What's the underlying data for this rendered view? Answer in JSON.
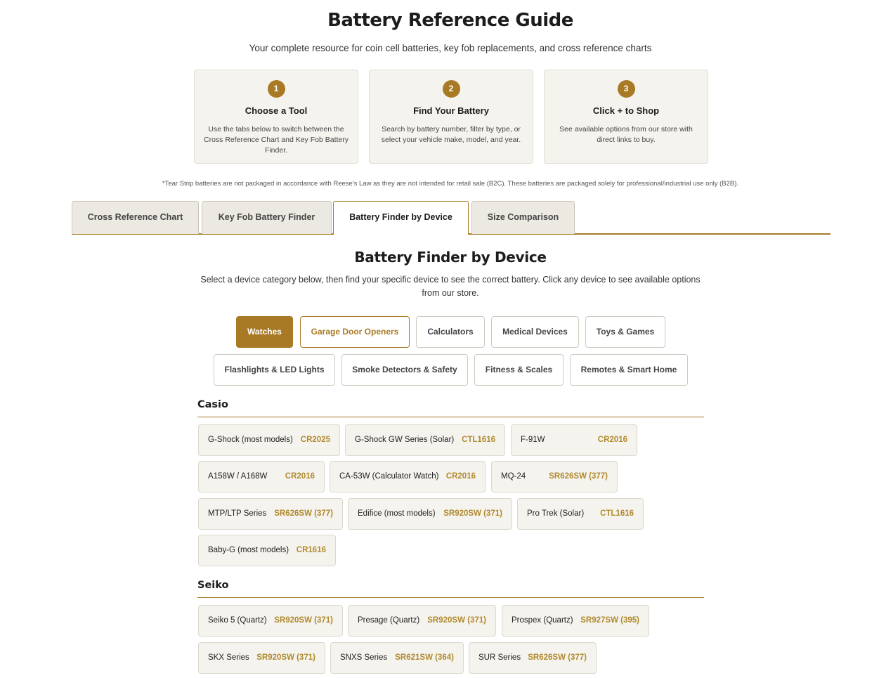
{
  "header": {
    "title": "Battery Reference Guide",
    "subtitle": "Your complete resource for coin cell batteries, key fob replacements, and cross reference charts"
  },
  "steps": [
    {
      "number": "1",
      "title": "Choose a Tool",
      "desc": "Use the tabs below to switch between the Cross Reference Chart and Key Fob Battery Finder."
    },
    {
      "number": "2",
      "title": "Find Your Battery",
      "desc": "Search by battery number, filter by type, or select your vehicle make, model, and year."
    },
    {
      "number": "3",
      "title": "Click + to Shop",
      "desc": "See available options from our store with direct links to buy."
    }
  ],
  "disclaimer": "*Tear Strip batteries are not packaged in accordance with Reese's Law as they are not intended for retail sale (B2C). These batteries are packaged solely for professional/industrial use only (B2B).",
  "tabs": [
    "Cross Reference Chart",
    "Key Fob Battery Finder",
    "Battery Finder by Device",
    "Size Comparison"
  ],
  "active_tab": "Battery Finder by Device",
  "section": {
    "title": "Battery Finder by Device",
    "desc": "Select a device category below, then find your specific device to see the correct battery. Click any device to see available options from our store."
  },
  "categories": [
    "Watches",
    "Garage Door Openers",
    "Calculators",
    "Medical Devices",
    "Toys & Games",
    "Flashlights & LED Lights",
    "Smoke Detectors & Safety",
    "Fitness & Scales",
    "Remotes & Smart Home"
  ],
  "active_category": "Watches",
  "brands": [
    {
      "name": "Casio",
      "devices": [
        {
          "name": "G-Shock (most models)",
          "battery": "CR2025"
        },
        {
          "name": "G-Shock GW Series (Solar)",
          "battery": "CTL1616"
        },
        {
          "name": "F-91W",
          "battery": "CR2016"
        },
        {
          "name": "A158W / A168W",
          "battery": "CR2016"
        },
        {
          "name": "CA-53W (Calculator Watch)",
          "battery": "CR2016"
        },
        {
          "name": "MQ-24",
          "battery": "SR626SW (377)"
        },
        {
          "name": "MTP/LTP Series",
          "battery": "SR626SW (377)"
        },
        {
          "name": "Edifice (most models)",
          "battery": "SR920SW (371)"
        },
        {
          "name": "Pro Trek (Solar)",
          "battery": "CTL1616"
        },
        {
          "name": "Baby-G (most models)",
          "battery": "CR1616"
        }
      ]
    },
    {
      "name": "Seiko",
      "devices": [
        {
          "name": "Seiko 5 (Quartz)",
          "battery": "SR920SW (371)"
        },
        {
          "name": "Presage (Quartz)",
          "battery": "SR920SW (371)"
        },
        {
          "name": "Prospex (Quartz)",
          "battery": "SR927SW (395)"
        },
        {
          "name": "SKX Series",
          "battery": "SR920SW (371)"
        },
        {
          "name": "SNXS Series",
          "battery": "SR621SW (364)"
        },
        {
          "name": "SUR Series",
          "battery": "SR626SW (377)"
        }
      ]
    }
  ],
  "colors": {
    "accent": "#a87a25",
    "battery_text": "#b08a2e",
    "card_bg": "#f5f3ee"
  }
}
